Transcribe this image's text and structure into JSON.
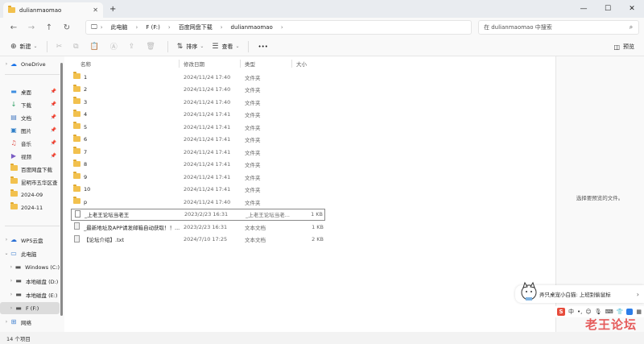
{
  "tab": {
    "title": "dulianmaomao"
  },
  "address": {
    "crumbs": [
      "此电脑",
      "F (F:)",
      "百度网盘下载",
      "dulianmaomao"
    ],
    "search_placeholder": "在 dulianmaomao 中搜索"
  },
  "toolbar": {
    "new_label": "新建",
    "sort_label": "排序",
    "view_label": "查看",
    "more_label": "•••",
    "preview_label": "预览"
  },
  "sidebar": {
    "onedrive": "OneDrive",
    "quick": [
      "桌面",
      "下载",
      "文档",
      "图片",
      "音乐",
      "视频",
      "百度网盘下载",
      "昆明市五华区查",
      "2024-09",
      "2024-11"
    ],
    "wps": "WPS云盘",
    "this_pc": "此电脑",
    "drives": [
      "Windows (C:)",
      "本地磁盘 (D:)",
      "本地磁盘 (E:)",
      "F (F:)"
    ],
    "network": "网络"
  },
  "columns": {
    "name": "名称",
    "date": "修改日期",
    "type": "类型",
    "size": "大小"
  },
  "files": [
    {
      "name": "1",
      "date": "2024/11/24 17:40",
      "type": "文件夹",
      "size": "",
      "kind": "folder"
    },
    {
      "name": "2",
      "date": "2024/11/24 17:40",
      "type": "文件夹",
      "size": "",
      "kind": "folder"
    },
    {
      "name": "3",
      "date": "2024/11/24 17:40",
      "type": "文件夹",
      "size": "",
      "kind": "folder"
    },
    {
      "name": "4",
      "date": "2024/11/24 17:41",
      "type": "文件夹",
      "size": "",
      "kind": "folder"
    },
    {
      "name": "5",
      "date": "2024/11/24 17:41",
      "type": "文件夹",
      "size": "",
      "kind": "folder"
    },
    {
      "name": "6",
      "date": "2024/11/24 17:41",
      "type": "文件夹",
      "size": "",
      "kind": "folder"
    },
    {
      "name": "7",
      "date": "2024/11/24 17:41",
      "type": "文件夹",
      "size": "",
      "kind": "folder"
    },
    {
      "name": "8",
      "date": "2024/11/24 17:41",
      "type": "文件夹",
      "size": "",
      "kind": "folder"
    },
    {
      "name": "9",
      "date": "2024/11/24 17:41",
      "type": "文件夹",
      "size": "",
      "kind": "folder"
    },
    {
      "name": "10",
      "date": "2024/11/24 17:41",
      "type": "文件夹",
      "size": "",
      "kind": "folder"
    },
    {
      "name": "p",
      "date": "2024/11/24 17:40",
      "type": "文件夹",
      "size": "",
      "kind": "folder"
    },
    {
      "name": "_上老王论坛当老王",
      "date": "2023/2/23 16:31",
      "type": "_上老王论坛当老...",
      "size": "1 KB",
      "kind": "file"
    },
    {
      "name": "_最新地址及APP请发邮箱自动获取！！...",
      "date": "2023/2/23 16:31",
      "type": "文本文档",
      "size": "1 KB",
      "kind": "txt"
    },
    {
      "name": "【论坛介绍】.txt",
      "date": "2024/7/10 17:25",
      "type": "文本文档",
      "size": "2 KB",
      "kind": "txt"
    }
  ],
  "preview_message": "选择要预览的文件。",
  "popup": {
    "text": "弄只桌宠小白猫: 上班别偷鼠标"
  },
  "ime": {
    "lang": "中"
  },
  "watermark": {
    "big": "老王论坛",
    "small": "laowang"
  },
  "status": {
    "count": "14 个项目"
  }
}
